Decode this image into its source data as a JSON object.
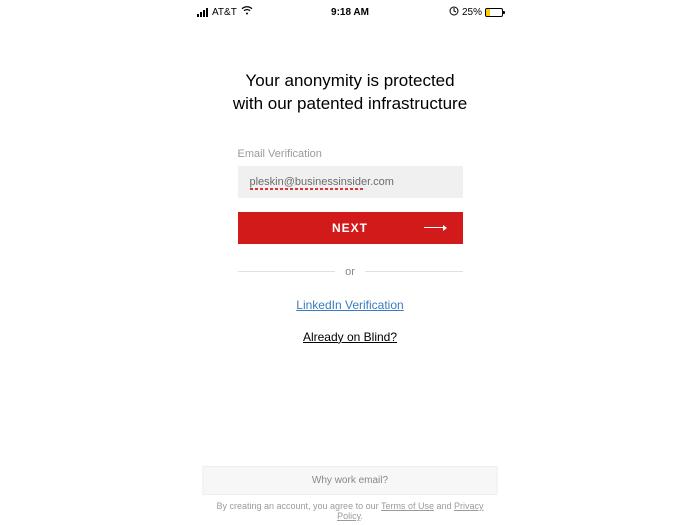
{
  "status_bar": {
    "carrier": "AT&T",
    "time": "9:18 AM",
    "battery_percent": "25%"
  },
  "heading": {
    "line1": "Your anonymity is protected",
    "line2": "with our patented infrastructure"
  },
  "form": {
    "email_label": "Email Verification",
    "email_value": "pleskin@businessinsider.com",
    "next_label": "NEXT"
  },
  "divider": {
    "text": "or"
  },
  "links": {
    "linkedin": "LinkedIn Verification",
    "already": "Already on Blind?"
  },
  "footer": {
    "why": "Why work email?",
    "legal_prefix": "By creating an account, you agree to our ",
    "terms": "Terms of Use",
    "and": " and ",
    "privacy": "Privacy Policy",
    "period": "."
  }
}
